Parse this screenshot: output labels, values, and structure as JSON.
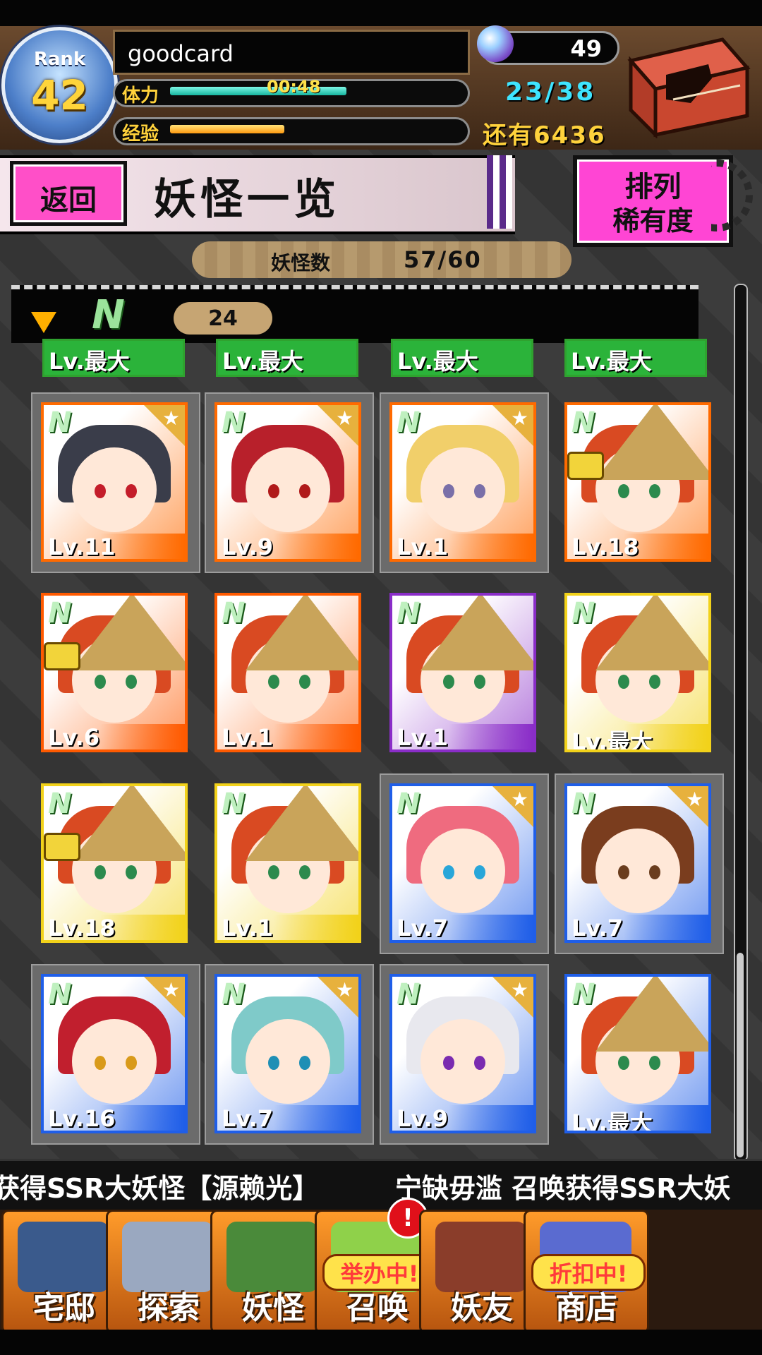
{
  "player": {
    "rank_label": "Rank",
    "rank": "42",
    "name": "goodcard",
    "gems": "49",
    "stamina_label": "体力",
    "stamina_timer": "00:48",
    "stamina": "23/38",
    "exp_label": "经验",
    "exp_remaining": "还有6436"
  },
  "header": {
    "back_label": "返回",
    "title": "妖怪一览",
    "sort_label": "排列",
    "sort_value": "稀有度"
  },
  "collection": {
    "count_label": "妖怪数",
    "count_value": "57/60",
    "section_rarity": "N",
    "section_count": "24"
  },
  "partial_row": [
    "Lv.最大",
    "Lv.最大",
    "Lv.最大",
    "Lv.最大"
  ],
  "cards": [
    {
      "level": "Lv.11",
      "rarity": "N",
      "star": true,
      "lock": false,
      "color": "#ff6a00",
      "hair": "#3a3d4a",
      "eye": "#c41d2a"
    },
    {
      "level": "Lv.9",
      "rarity": "N",
      "star": true,
      "lock": false,
      "color": "#ff6a00",
      "hair": "#b8202b",
      "eye": "#b01a1a"
    },
    {
      "level": "Lv.1",
      "rarity": "N",
      "star": true,
      "lock": false,
      "color": "#ff6a00",
      "hair": "#f1cf6a",
      "eye": "#7a6fa8"
    },
    {
      "level": "Lv.18",
      "rarity": "N",
      "star": false,
      "lock": true,
      "color": "#ff6a00",
      "hair": "#d94a22",
      "eye": "#2c8a4d"
    },
    {
      "level": "Lv.6",
      "rarity": "N",
      "star": false,
      "lock": true,
      "color": "#ff5a00",
      "hair": "#d94a22",
      "eye": "#2c8a4d"
    },
    {
      "level": "Lv.1",
      "rarity": "N",
      "star": false,
      "lock": false,
      "color": "#ff5a00",
      "hair": "#d94a22",
      "eye": "#2c8a4d"
    },
    {
      "level": "Lv.1",
      "rarity": "N",
      "star": false,
      "lock": false,
      "color": "#8a2dc8",
      "hair": "#d94a22",
      "eye": "#2c8a4d"
    },
    {
      "level": "Lv.最大",
      "rarity": "N",
      "star": false,
      "lock": false,
      "color": "#f2d21a",
      "hair": "#d94a22",
      "eye": "#2c8a4d"
    },
    {
      "level": "Lv.18",
      "rarity": "N",
      "star": false,
      "lock": true,
      "color": "#f2d21a",
      "hair": "#d94a22",
      "eye": "#2c8a4d"
    },
    {
      "level": "Lv.1",
      "rarity": "N",
      "star": false,
      "lock": false,
      "color": "#f2d21a",
      "hair": "#d94a22",
      "eye": "#2c8a4d"
    },
    {
      "level": "Lv.7",
      "rarity": "N",
      "star": true,
      "lock": false,
      "color": "#1f5ee8",
      "hair": "#ef6b7f",
      "eye": "#28a6d9"
    },
    {
      "level": "Lv.7",
      "rarity": "N",
      "star": true,
      "lock": false,
      "color": "#1f5ee8",
      "hair": "#7a3d1e",
      "eye": "#6a3d1e"
    },
    {
      "level": "Lv.16",
      "rarity": "N",
      "star": true,
      "lock": false,
      "color": "#1f5ee8",
      "hair": "#c11f2e",
      "eye": "#d99a1a"
    },
    {
      "level": "Lv.7",
      "rarity": "N",
      "star": true,
      "lock": false,
      "color": "#1f5ee8",
      "hair": "#7fcac9",
      "eye": "#1f8fb5"
    },
    {
      "level": "Lv.9",
      "rarity": "N",
      "star": true,
      "lock": false,
      "color": "#1f5ee8",
      "hair": "#e8e8ee",
      "eye": "#7a2bb0"
    },
    {
      "level": "Lv.最大",
      "rarity": "N",
      "star": false,
      "lock": false,
      "color": "#1f5ee8",
      "hair": "#d94a22",
      "eye": "#2c8a4d"
    }
  ],
  "ticker": {
    "part1": "获得SSR大妖怪【源赖光】",
    "part2": "宁缺毋滥 召唤获得SSR大妖"
  },
  "nav": [
    {
      "label": "宅邸",
      "icon": "house-icon",
      "color": "#3a5a8c"
    },
    {
      "label": "探索",
      "icon": "magnifier-icon",
      "color": "#9aa8c0"
    },
    {
      "label": "妖怪",
      "icon": "scroll-icon",
      "color": "#4a8a3a"
    },
    {
      "label": "召唤",
      "icon": "star-icon",
      "color": "#8fd14a",
      "badge": "举办中!",
      "alert": "!"
    },
    {
      "label": "妖友",
      "icon": "friend-icon",
      "color": "#8a3d2a"
    },
    {
      "label": "商店",
      "icon": "orb-icon",
      "color": "#5a6bd0",
      "badge": "折扣中!"
    }
  ]
}
